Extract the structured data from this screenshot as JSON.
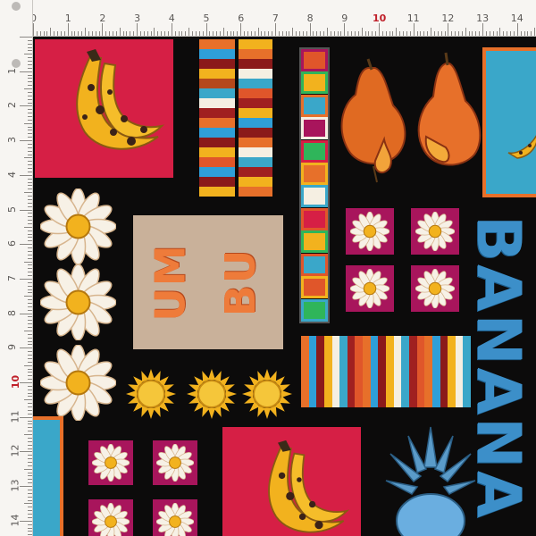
{
  "ruler": {
    "top_numbers": [
      "0",
      "1",
      "2",
      "3",
      "4",
      "5",
      "6",
      "7",
      "8",
      "9",
      "10",
      "11",
      "12",
      "13",
      "14"
    ],
    "left_numbers": [
      "1",
      "2",
      "3",
      "4",
      "5",
      "6",
      "7",
      "8",
      "9",
      "10",
      "11",
      "12",
      "13",
      "14"
    ],
    "accent_number": "10"
  },
  "fabric": {
    "word_tile_line1": "UM",
    "word_tile_line2": "BU",
    "banana_word": "BANANA"
  },
  "colors": {
    "background": "#0c0b0b",
    "red": "#d61f45",
    "magenta": "#a8155c",
    "blue": "#3aa7c9",
    "orange": "#e7702a",
    "yellow": "#f2b21e"
  },
  "icons": [
    "banana-icon",
    "flower-icon",
    "sun-icon",
    "pear-icon",
    "pineapple-icon",
    "pin-icon"
  ]
}
